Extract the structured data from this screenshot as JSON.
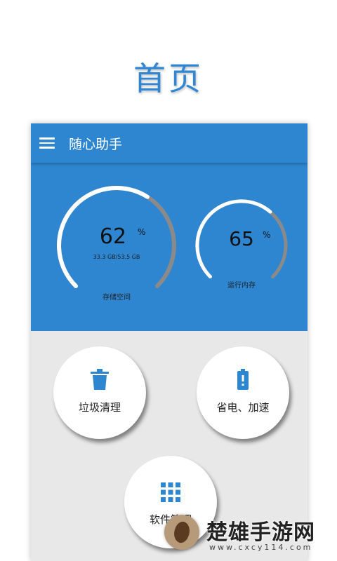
{
  "page_title": "首页",
  "app": {
    "title": "随心助手"
  },
  "storage": {
    "value": "62",
    "unit": "%",
    "detail": "33.3 GB/53.5 GB",
    "label": "存储空间",
    "fraction": 0.62
  },
  "memory": {
    "value": "65",
    "unit": "%",
    "label": "运行内存",
    "fraction": 0.65
  },
  "actions": [
    {
      "label": "垃圾清理",
      "icon": "trash-icon"
    },
    {
      "label": "省电、加速",
      "icon": "battery-icon"
    },
    {
      "label": "软件管理",
      "icon": "grid-apps-icon"
    }
  ],
  "watermark": {
    "text": "楚雄手游网",
    "url": "www.cxcy114.com"
  },
  "colors": {
    "primary": "#2e86d1",
    "gauge_track": "#8a8a8a",
    "gauge_fill": "#ffffff",
    "background": "#e8e8e8"
  }
}
